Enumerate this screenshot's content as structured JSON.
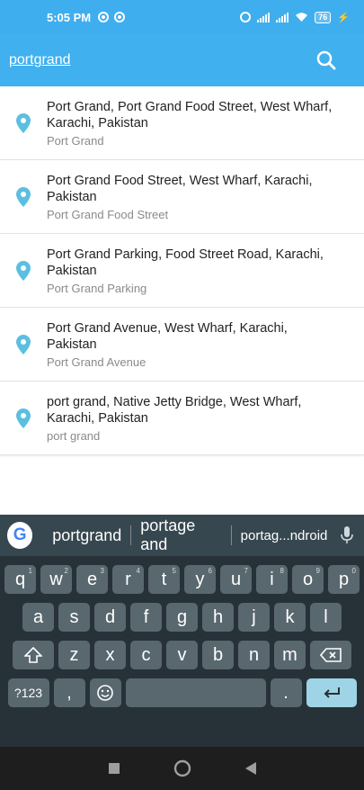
{
  "status": {
    "time": "5:05 PM",
    "battery": "76"
  },
  "search": {
    "query": "portgrand"
  },
  "results": [
    {
      "title": "Port Grand, Port Grand Food Street, West Wharf, Karachi, Pakistan",
      "subtitle": "Port Grand"
    },
    {
      "title": "Port Grand Food Street, West Wharf, Karachi, Pakistan",
      "subtitle": "Port Grand Food Street"
    },
    {
      "title": "Port Grand Parking, Food Street Road, Karachi, Pakistan",
      "subtitle": "Port Grand Parking"
    },
    {
      "title": "Port Grand Avenue, West Wharf, Karachi, Pakistan",
      "subtitle": "Port Grand Avenue"
    },
    {
      "title": "port grand, Native Jetty Bridge, West Wharf, Karachi, Pakistan",
      "subtitle": "port grand"
    }
  ],
  "keyboard": {
    "logo": "G",
    "suggestions": [
      "portgrand",
      "portage and",
      "portag...ndroid"
    ],
    "row1": [
      {
        "k": "q",
        "n": "1"
      },
      {
        "k": "w",
        "n": "2"
      },
      {
        "k": "e",
        "n": "3"
      },
      {
        "k": "r",
        "n": "4"
      },
      {
        "k": "t",
        "n": "5"
      },
      {
        "k": "y",
        "n": "6"
      },
      {
        "k": "u",
        "n": "7"
      },
      {
        "k": "i",
        "n": "8"
      },
      {
        "k": "o",
        "n": "9"
      },
      {
        "k": "p",
        "n": "0"
      }
    ],
    "row2": [
      "a",
      "s",
      "d",
      "f",
      "g",
      "h",
      "j",
      "k",
      "l"
    ],
    "row3": [
      "z",
      "x",
      "c",
      "v",
      "b",
      "n",
      "m"
    ],
    "symbols_label": "?123",
    "comma": ",",
    "period": "."
  },
  "colors": {
    "accent": "#40b0ef",
    "pin": "#5bbfe0"
  }
}
